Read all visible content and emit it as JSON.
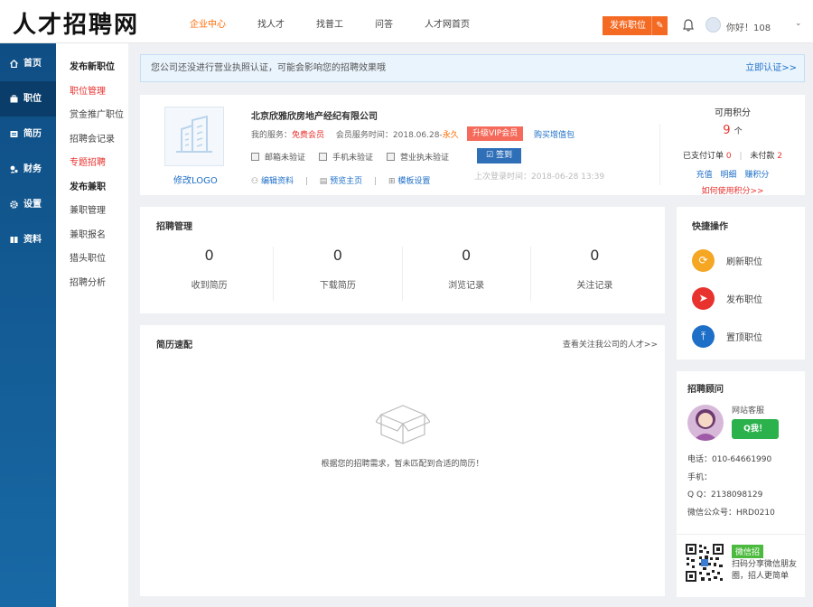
{
  "header": {
    "logo": "人才招聘网",
    "nav": [
      {
        "label": "企业中心",
        "active": true
      },
      {
        "label": "找人才",
        "active": false
      },
      {
        "label": "找普工",
        "active": false
      },
      {
        "label": "问答",
        "active": false
      },
      {
        "label": "人才网首页",
        "active": false
      }
    ],
    "publish_label": "发布职位",
    "greeting": "你好！108"
  },
  "sidebar": {
    "items": [
      {
        "label": "首页",
        "icon": "home-icon"
      },
      {
        "label": "职位",
        "icon": "briefcase-icon",
        "active": true
      },
      {
        "label": "简历",
        "icon": "resume-icon"
      },
      {
        "label": "财务",
        "icon": "finance-icon"
      },
      {
        "label": "设置",
        "icon": "gear-icon"
      },
      {
        "label": "资料",
        "icon": "profile-icon"
      }
    ]
  },
  "subnav": {
    "items": [
      {
        "label": "发布新职位",
        "style": "bold"
      },
      {
        "label": "职位管理",
        "style": "red"
      },
      {
        "label": "赏金推广职位",
        "style": ""
      },
      {
        "label": "招聘会记录",
        "style": ""
      },
      {
        "label": "专题招聘",
        "style": "red"
      },
      {
        "label": "发布兼职",
        "style": "bold"
      },
      {
        "label": "兼职管理",
        "style": ""
      },
      {
        "label": "兼职报名",
        "style": ""
      },
      {
        "label": "猎头职位",
        "style": ""
      },
      {
        "label": "招聘分析",
        "style": ""
      }
    ]
  },
  "notice": {
    "text": "您公司还没进行营业执照认证，可能会影响您的招聘效果哦",
    "link": "立即认证>>"
  },
  "company": {
    "edit_logo": "修改LOGO",
    "name": "北京欣雅欣房地产经纪有限公司",
    "service_label": "我的服务：",
    "service_value": "免费会员",
    "service_time_label": "会员服务时间：2018.06.28-",
    "service_time_value": "永久",
    "vip_button": "升级VIP会员",
    "buy_link": "购买增值包",
    "verify": [
      "邮箱未验证",
      "手机未验证",
      "营业执未验证"
    ],
    "sign_button": "签到",
    "links": [
      "编辑资料",
      "预览主页",
      "模板设置"
    ],
    "last_login": "上次登录时间：2018-06-28 13:39"
  },
  "points": {
    "title": "可用积分",
    "value": "9",
    "unit": "个",
    "paid_label": "已支付订单",
    "paid_value": "0",
    "unpaid_label": "未付款",
    "unpaid_value": "2",
    "links": [
      "充值",
      "明细",
      "赚积分"
    ],
    "howto": "如何使用积分>>"
  },
  "recruit": {
    "title": "招聘管理",
    "stats": [
      {
        "value": "0",
        "label": "收到简历"
      },
      {
        "value": "0",
        "label": "下载简历"
      },
      {
        "value": "0",
        "label": "浏览记录"
      },
      {
        "value": "0",
        "label": "关注记录"
      }
    ]
  },
  "quick": {
    "title": "快捷操作",
    "items": [
      {
        "label": "刷新职位",
        "icon": "refresh-icon",
        "color": "#f5a623"
      },
      {
        "label": "发布职位",
        "icon": "send-icon",
        "color": "#e8322e"
      },
      {
        "label": "置顶职位",
        "icon": "top-icon",
        "color": "#1e6fc8"
      }
    ]
  },
  "match": {
    "title": "简历速配",
    "more": "查看关注我公司的人才>>",
    "empty": "根据您的招聘需求，暂未匹配到合适的简历！"
  },
  "advisor": {
    "title": "招聘顾问",
    "service": "网站客服",
    "qq_button": "Q我！",
    "phone": "电话：010-64661990",
    "mobile": "手机：",
    "qq": "Q Q：2138098129",
    "wechat": "微信公众号：HRD0210",
    "wx_tag": "微信招",
    "wx_text": "扫码分享微信朋友圈，招人更简单"
  },
  "colors": {
    "accent": "#ff6a00",
    "sidebar": "#0f4e84",
    "link": "#1e6fc8",
    "alert": "#e8322e"
  }
}
